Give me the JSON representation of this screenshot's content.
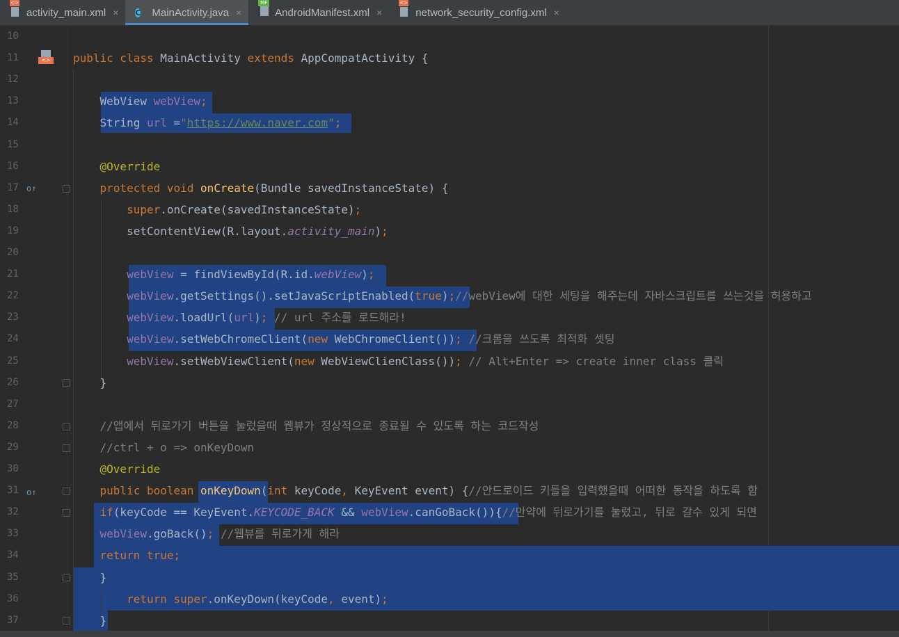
{
  "tabs": [
    {
      "name": "activity_main.xml",
      "type": "xml",
      "active": false
    },
    {
      "name": "MainActivity.java",
      "type": "class",
      "active": true
    },
    {
      "name": "AndroidManifest.xml",
      "type": "manifest",
      "active": false
    },
    {
      "name": "network_security_config.xml",
      "type": "xml",
      "active": false
    }
  ],
  "tab_close_glyph": "×",
  "gutter_icons": {
    "class_badge": "<>",
    "manifest_badge": "MF",
    "class_letter": "C",
    "override_glyph": "o↑"
  },
  "colors": {
    "keyword": "#cc7832",
    "field": "#9876aa",
    "string": "#6a8759",
    "annotation": "#bbb529",
    "method": "#ffc66d",
    "comment": "#808080",
    "selection": "#214283",
    "accent": "#4a88c7"
  },
  "lines": [
    {
      "n": "10",
      "tokens": []
    },
    {
      "n": "11",
      "tokens": [
        [
          "kw",
          "public class "
        ],
        [
          "p",
          "MainActivity "
        ],
        [
          "kw",
          "extends "
        ],
        [
          "p",
          "AppCompatActivity {"
        ]
      ]
    },
    {
      "n": "12",
      "tokens": []
    },
    {
      "n": "13",
      "tokens": [
        [
          "p",
          "    WebView "
        ],
        [
          "fld",
          "webView"
        ],
        [
          "kw",
          ";"
        ]
      ]
    },
    {
      "n": "14",
      "tokens": [
        [
          "p",
          "    String "
        ],
        [
          "fld",
          "url "
        ],
        [
          "p",
          "="
        ],
        [
          "str",
          "\""
        ],
        [
          "url",
          "https://www.naver.com"
        ],
        [
          "str",
          "\""
        ],
        [
          "kw",
          ";"
        ]
      ]
    },
    {
      "n": "15",
      "tokens": []
    },
    {
      "n": "16",
      "tokens": [
        [
          "ann",
          "    @Override"
        ]
      ]
    },
    {
      "n": "17",
      "tokens": [
        [
          "kw",
          "    protected void "
        ],
        [
          "mth",
          "onCreate"
        ],
        [
          "p",
          "(Bundle savedInstanceState) {"
        ]
      ]
    },
    {
      "n": "18",
      "tokens": [
        [
          "kw",
          "        super"
        ],
        [
          "p",
          ".onCreate(savedInstanceState)"
        ],
        [
          "kw",
          ";"
        ]
      ]
    },
    {
      "n": "19",
      "tokens": [
        [
          "p",
          "        setContentView(R.layout."
        ],
        [
          "ital",
          "activity_main"
        ],
        [
          "p",
          ")"
        ],
        [
          "kw",
          ";"
        ]
      ]
    },
    {
      "n": "20",
      "tokens": []
    },
    {
      "n": "21",
      "tokens": [
        [
          "fld",
          "        webView "
        ],
        [
          "p",
          "= findViewById(R.id."
        ],
        [
          "ital",
          "webView"
        ],
        [
          "p",
          ")"
        ],
        [
          "kw",
          ";"
        ]
      ]
    },
    {
      "n": "22",
      "tokens": [
        [
          "fld",
          "        webView"
        ],
        [
          "p",
          ".getSettings().setJavaScriptEnabled("
        ],
        [
          "kw",
          "true"
        ],
        [
          "p",
          ")"
        ],
        [
          "kw",
          ";"
        ],
        [
          "cmt",
          "//webView에 대한 세팅을 해주는데 자바스크립트를 쓰는것을 허용하고"
        ]
      ]
    },
    {
      "n": "23",
      "tokens": [
        [
          "fld",
          "        webView"
        ],
        [
          "p",
          ".loadUrl("
        ],
        [
          "fld",
          "url"
        ],
        [
          "p",
          ")"
        ],
        [
          "kw",
          ";"
        ],
        [
          "cmt",
          " // url 주소를 로드해라!"
        ]
      ]
    },
    {
      "n": "24",
      "tokens": [
        [
          "fld",
          "        webView"
        ],
        [
          "p",
          ".setWebChromeClient("
        ],
        [
          "kw",
          "new "
        ],
        [
          "p",
          "WebChromeClient())"
        ],
        [
          "kw",
          ";"
        ],
        [
          "cmt",
          " //크롬을 쓰도록 최적화 셋팅"
        ]
      ]
    },
    {
      "n": "25",
      "tokens": [
        [
          "fld",
          "        webView"
        ],
        [
          "p",
          ".setWebViewClient("
        ],
        [
          "kw",
          "new "
        ],
        [
          "p",
          "WebViewClienClass())"
        ],
        [
          "kw",
          ";"
        ],
        [
          "cmt",
          " // Alt+Enter => create inner class 클릭"
        ]
      ]
    },
    {
      "n": "26",
      "tokens": [
        [
          "p",
          "    }"
        ]
      ]
    },
    {
      "n": "27",
      "tokens": []
    },
    {
      "n": "28",
      "tokens": [
        [
          "cmt",
          "    //앱에서 뒤로가기 버튼을 눌렀을때 웹뷰가 정상적으로 종료될 수 있도록 하는 코드작성"
        ]
      ]
    },
    {
      "n": "29",
      "tokens": [
        [
          "cmt",
          "    //ctrl + o => onKeyDown"
        ]
      ]
    },
    {
      "n": "30",
      "tokens": [
        [
          "ann",
          "    @Override"
        ]
      ]
    },
    {
      "n": "31",
      "tokens": [
        [
          "kw",
          "    public boolean "
        ],
        [
          "mth",
          "onKeyDown"
        ],
        [
          "p",
          "("
        ],
        [
          "kw",
          "int "
        ],
        [
          "p",
          "keyCode"
        ],
        [
          "kw",
          ", "
        ],
        [
          "p",
          "KeyEvent event) {"
        ],
        [
          "cmt",
          "//안드로이드 키들을 입력했을때 어떠한 동작을 하도록 함"
        ]
      ]
    },
    {
      "n": "32",
      "tokens": [
        [
          "kw",
          "    if"
        ],
        [
          "p",
          "(keyCode == KeyEvent."
        ],
        [
          "ital",
          "KEYCODE_BACK "
        ],
        [
          "p",
          "&& "
        ],
        [
          "fld",
          "webView"
        ],
        [
          "p",
          ".canGoBack()){"
        ],
        [
          "cmt",
          "//만약에 뒤로가기를 눌렀고, 뒤로 갈수 있게 되면"
        ]
      ]
    },
    {
      "n": "33",
      "tokens": [
        [
          "fld",
          "    webView"
        ],
        [
          "p",
          ".goBack()"
        ],
        [
          "kw",
          ";"
        ],
        [
          "cmt",
          " //웹뷰를 뒤로가게 해라"
        ]
      ]
    },
    {
      "n": "34",
      "tokens": [
        [
          "kw",
          "    return true;"
        ]
      ]
    },
    {
      "n": "35",
      "tokens": [
        [
          "p",
          "    }"
        ]
      ]
    },
    {
      "n": "36",
      "tokens": [
        [
          "kw",
          "        return super"
        ],
        [
          "p",
          ".onKeyDown(keyCode"
        ],
        [
          "kw",
          ", "
        ],
        [
          "p",
          "event)"
        ],
        [
          "kw",
          ";"
        ]
      ]
    },
    {
      "n": "37",
      "tokens": [
        [
          "p",
          "    }"
        ]
      ]
    }
  ]
}
